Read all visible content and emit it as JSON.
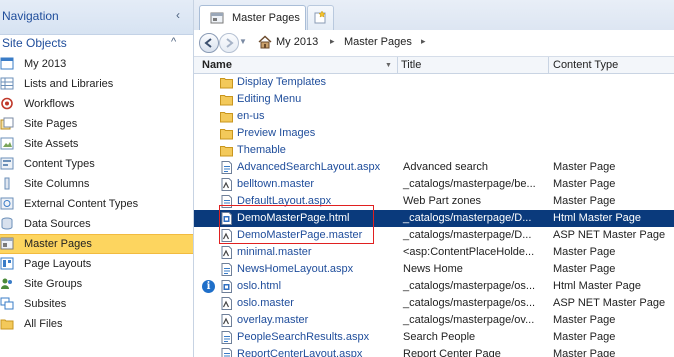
{
  "navigation": {
    "title": "Navigation",
    "collapse_glyph": "‹",
    "section_title": "Site Objects",
    "section_glyph": "^",
    "items": [
      {
        "label": "My 2013",
        "icon": "site-icon",
        "color": "#3a7cc7"
      },
      {
        "label": "Lists and Libraries",
        "icon": "list-icon",
        "color": "#6b8fb8"
      },
      {
        "label": "Workflows",
        "icon": "workflow-icon",
        "color": "#c0392b"
      },
      {
        "label": "Site Pages",
        "icon": "pages-icon",
        "color": "#e8b33a"
      },
      {
        "label": "Site Assets",
        "icon": "assets-icon",
        "color": "#6b8fb8"
      },
      {
        "label": "Content Types",
        "icon": "content-types-icon",
        "color": "#6b8fb8"
      },
      {
        "label": "Site Columns",
        "icon": "columns-icon",
        "color": "#6b8fb8"
      },
      {
        "label": "External Content Types",
        "icon": "external-content-icon",
        "color": "#6b8fb8"
      },
      {
        "label": "Data Sources",
        "icon": "data-sources-icon",
        "color": "#6b8fb8"
      },
      {
        "label": "Master Pages",
        "icon": "master-pages-icon",
        "color": "#7a7a7a",
        "selected": true
      },
      {
        "label": "Page Layouts",
        "icon": "page-layouts-icon",
        "color": "#3a7cc7"
      },
      {
        "label": "Site Groups",
        "icon": "groups-icon",
        "color": "#4a8a3a"
      },
      {
        "label": "Subsites",
        "icon": "subsites-icon",
        "color": "#3a7cc7"
      },
      {
        "label": "All Files",
        "icon": "folder-icon",
        "color": "#e8b33a"
      }
    ]
  },
  "tab": {
    "label": "Master Pages",
    "icon": "master-pages-icon",
    "new_tab_icon": "new-tab-icon"
  },
  "address": {
    "crumbs": [
      "My 2013",
      "Master Pages"
    ],
    "separator": "▸"
  },
  "table": {
    "columns": [
      "Name",
      "Title",
      "Content Type"
    ],
    "rows": [
      {
        "name": "Display Templates",
        "title": "",
        "type": "",
        "icon": "folder-icon"
      },
      {
        "name": "Editing Menu",
        "title": "",
        "type": "",
        "icon": "folder-icon"
      },
      {
        "name": "en-us",
        "title": "",
        "type": "",
        "icon": "folder-icon"
      },
      {
        "name": "Preview Images",
        "title": "",
        "type": "",
        "icon": "folder-icon"
      },
      {
        "name": "Themable",
        "title": "",
        "type": "",
        "icon": "folder-icon"
      },
      {
        "name": "AdvancedSearchLayout.aspx",
        "title": "Advanced search",
        "type": "Master Page",
        "icon": "aspx-file-icon"
      },
      {
        "name": "belltown.master",
        "title": "_catalogs/masterpage/be...",
        "type": "Master Page",
        "icon": "master-file-icon"
      },
      {
        "name": "DefaultLayout.aspx",
        "title": "Web Part zones",
        "type": "Master Page",
        "icon": "aspx-file-icon"
      },
      {
        "name": "DemoMasterPage.html",
        "title": "_catalogs/masterpage/D...",
        "type": "Html Master Page",
        "icon": "html-file-icon",
        "selected": true
      },
      {
        "name": "DemoMasterPage.master",
        "title": "_catalogs/masterpage/D...",
        "type": "ASP NET Master Page",
        "icon": "master-file-icon"
      },
      {
        "name": "minimal.master",
        "title": "<asp:ContentPlaceHolde...",
        "type": "Master Page",
        "icon": "master-file-icon"
      },
      {
        "name": "NewsHomeLayout.aspx",
        "title": "News Home",
        "type": "Master Page",
        "icon": "aspx-file-icon"
      },
      {
        "name": "oslo.html",
        "title": "_catalogs/masterpage/os...",
        "type": "Html Master Page",
        "icon": "html-file-icon",
        "info": "i"
      },
      {
        "name": "oslo.master",
        "title": "_catalogs/masterpage/os...",
        "type": "ASP NET Master Page",
        "icon": "master-file-icon"
      },
      {
        "name": "overlay.master",
        "title": "_catalogs/masterpage/ov...",
        "type": "Master Page",
        "icon": "master-file-icon"
      },
      {
        "name": "PeopleSearchResults.aspx",
        "title": "Search People",
        "type": "Master Page",
        "icon": "aspx-file-icon"
      },
      {
        "name": "ReportCenterLayout.aspx",
        "title": "Report Center Page",
        "type": "Master Page",
        "icon": "aspx-file-icon"
      }
    ]
  },
  "colors": {
    "selection_nav": "#fdd55f",
    "selection_row": "#0a3a7c",
    "link": "#1f4d9b",
    "highlight": "#e02020"
  }
}
